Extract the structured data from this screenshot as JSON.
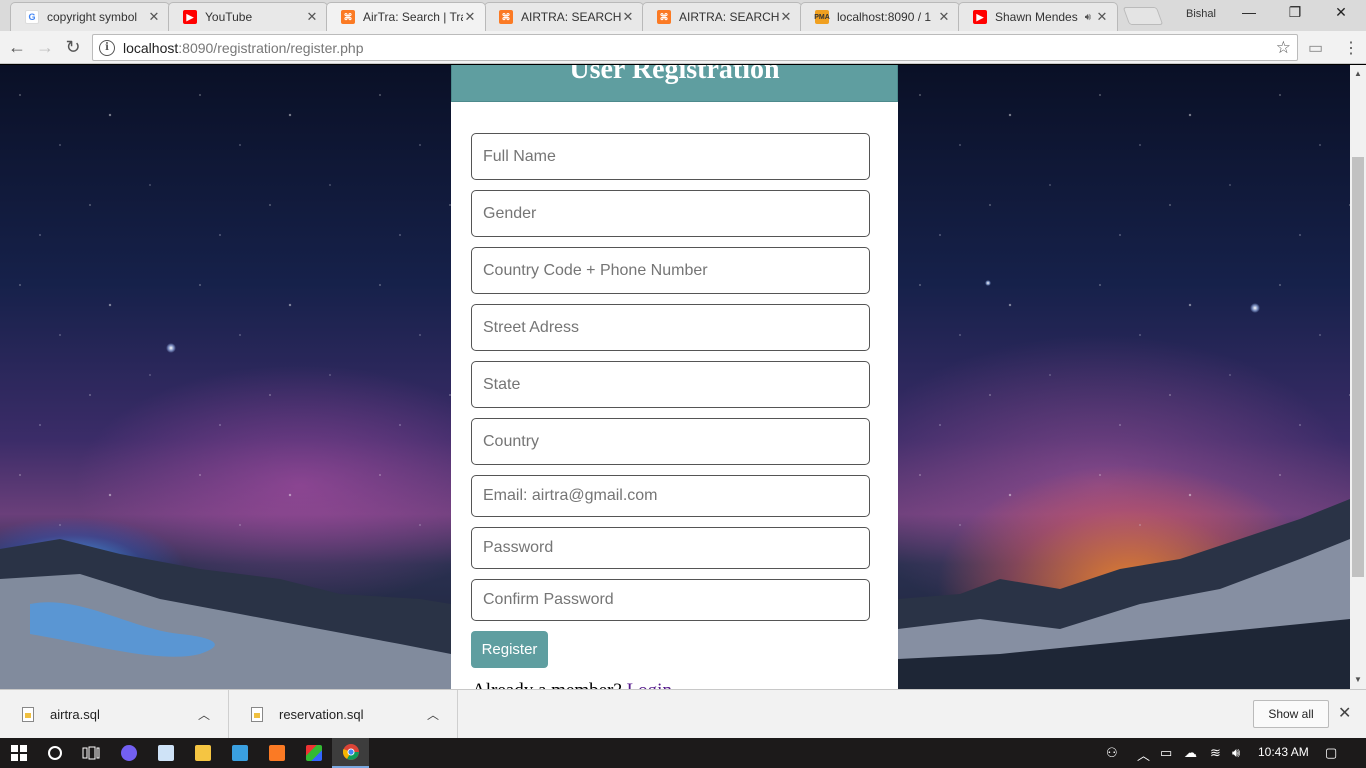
{
  "browser": {
    "tabs": [
      {
        "title": "copyright symbol",
        "favicon": "google-icon"
      },
      {
        "title": "YouTube",
        "favicon": "youtube-icon"
      },
      {
        "title": "AirTra: Search | Tra",
        "favicon": "xampp-icon",
        "active": true
      },
      {
        "title": "AIRTRA: SEARCH |",
        "favicon": "xampp-icon"
      },
      {
        "title": "AIRTRA: SEARCH |",
        "favicon": "xampp-icon"
      },
      {
        "title": "localhost:8090 / 1",
        "favicon": "phpmyadmin-icon"
      },
      {
        "title": "Shawn Mendes",
        "favicon": "youtube-icon",
        "audio": true
      }
    ],
    "profile_name": "Bishal",
    "url_host": "localhost",
    "url_rest": ":8090/registration/register.php"
  },
  "form": {
    "heading": "User Registration",
    "fields": [
      {
        "placeholder": "Full Name"
      },
      {
        "placeholder": "Gender"
      },
      {
        "placeholder": "Country Code + Phone Number"
      },
      {
        "placeholder": "Street Adress"
      },
      {
        "placeholder": "State"
      },
      {
        "placeholder": "Country"
      },
      {
        "placeholder": "Email: airtra@gmail.com"
      },
      {
        "placeholder": "Password"
      },
      {
        "placeholder": "Confirm Password"
      }
    ],
    "register_label": "Register",
    "member_text": "Already a member?",
    "login_label": "Login",
    "accent_color": "#5f9ea0"
  },
  "downloads": {
    "items": [
      {
        "name": "airtra.sql"
      },
      {
        "name": "reservation.sql"
      }
    ],
    "show_all_label": "Show all"
  },
  "taskbar": {
    "time": "10:43 AM"
  }
}
